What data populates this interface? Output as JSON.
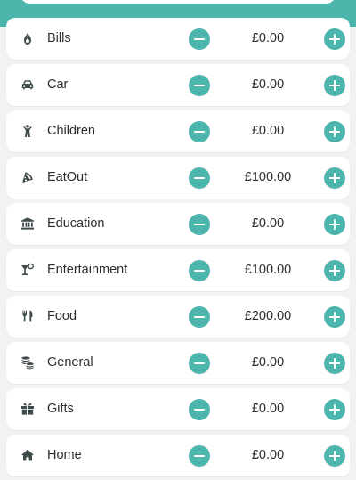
{
  "theme": {
    "accent": "#4db6ac",
    "background": "#f1f3f3",
    "text": "#2c2c2c"
  },
  "categories": [
    {
      "label": "Bills",
      "amount": "£0.00",
      "icon": "flame-icon"
    },
    {
      "label": "Car",
      "amount": "£0.00",
      "icon": "car-icon"
    },
    {
      "label": "Children",
      "amount": "£0.00",
      "icon": "child-icon"
    },
    {
      "label": "EatOut",
      "amount": "£100.00",
      "icon": "pizza-icon"
    },
    {
      "label": "Education",
      "amount": "£0.00",
      "icon": "institution-icon"
    },
    {
      "label": "Entertainment",
      "amount": "£100.00",
      "icon": "cocktail-icon"
    },
    {
      "label": "Food",
      "amount": "£200.00",
      "icon": "cutlery-icon"
    },
    {
      "label": "General",
      "amount": "£0.00",
      "icon": "coins-icon"
    },
    {
      "label": "Gifts",
      "amount": "£0.00",
      "icon": "gift-icon"
    },
    {
      "label": "Home",
      "amount": "£0.00",
      "icon": "home-icon"
    }
  ]
}
